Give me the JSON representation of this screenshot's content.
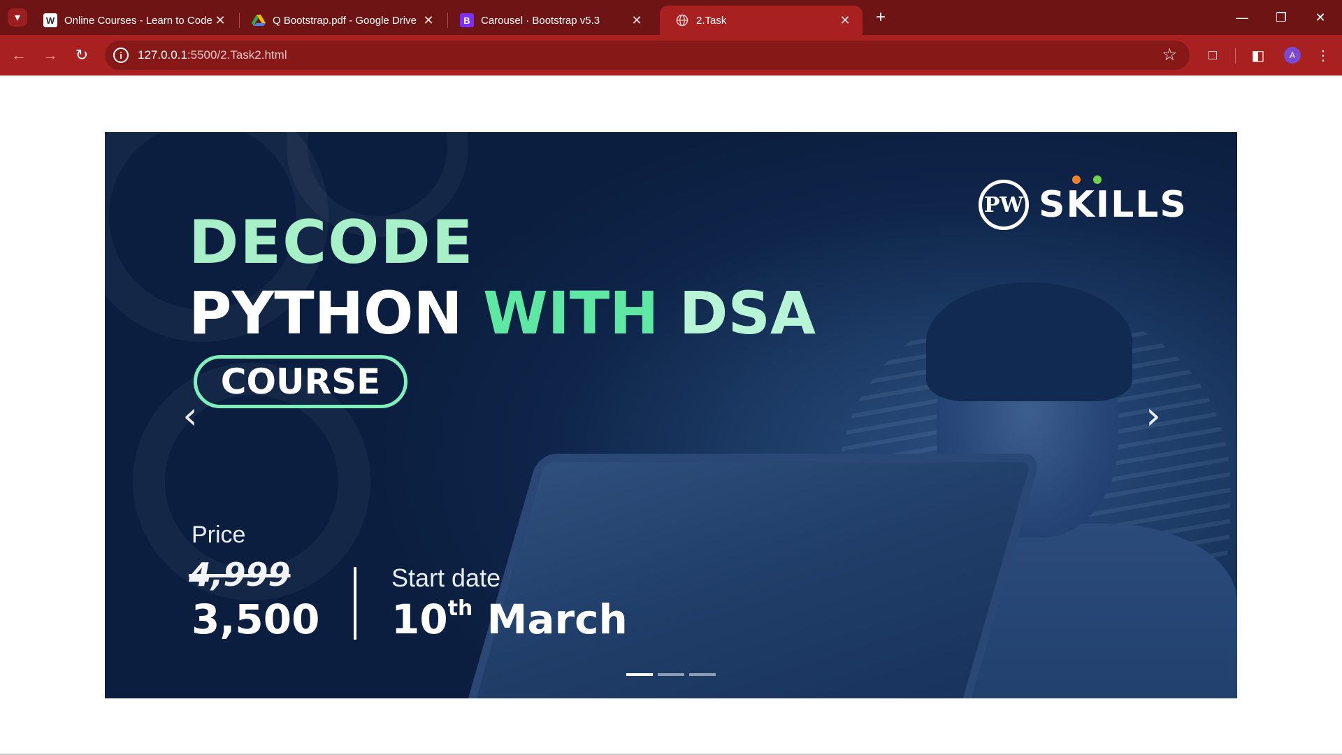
{
  "browser": {
    "tabs": [
      {
        "title": "Online Courses - Learn to Code",
        "favicon": "wordpress-icon",
        "active": false
      },
      {
        "title": "Q Bootstrap.pdf - Google Drive",
        "favicon": "google-drive-icon",
        "active": false
      },
      {
        "title": "Carousel · Bootstrap v5.3",
        "favicon": "bootstrap-icon",
        "favicon_text": "B",
        "active": false
      },
      {
        "title": "2.Task",
        "favicon": "globe-icon",
        "active": true
      }
    ],
    "url_host": "127.0.0.1",
    "url_path": ":5500/2.Task2.html",
    "avatar_letter": "A",
    "colors": {
      "frame": "#6e1414",
      "toolbar": "#a82020",
      "omnibox": "#861818"
    }
  },
  "slide": {
    "brand": "SKILLS",
    "brand_badge": "PW",
    "headline_1": "DECODE",
    "headline_2a": "PYTHON",
    "headline_2b": "WITH",
    "headline_2c": "DSA",
    "course_label": "COURSE",
    "price_label": "Price",
    "old_price": "4,999",
    "new_price": "3,500",
    "start_label": "Start date",
    "start_day": "10",
    "start_day_suffix": "th",
    "start_month": "March",
    "colors": {
      "background": "#0e2448",
      "accent_green": "#5fe8a4",
      "dot_orange": "#f2802a",
      "dot_green": "#6fd44a"
    }
  },
  "carousel": {
    "slide_count": 3,
    "active_index": 0,
    "prev_icon": "chevron-left-icon",
    "next_icon": "chevron-right-icon"
  }
}
